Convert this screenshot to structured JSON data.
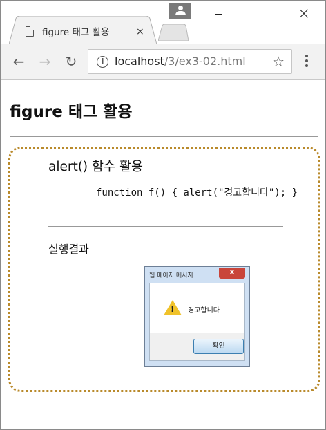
{
  "browser": {
    "tab_title": "figure 태그 활용",
    "tab_close": "×",
    "url_host": "localhost",
    "url_path": "/3/ex3-02.html",
    "nav": {
      "back": "←",
      "forward": "→",
      "reload": "↻"
    },
    "info_icon": "i",
    "star_icon": "☆"
  },
  "page": {
    "heading": "figure 태그 활용",
    "figure": {
      "title": "alert() 함수 활용",
      "code": "function f() { alert(\"경고합니다\"); }",
      "caption": "실행결과",
      "dialog": {
        "title": "웹 페이지 메시지",
        "close": "X",
        "message": "경고합니다",
        "warning_mark": "!",
        "ok_label": "확인"
      }
    }
  },
  "colors": {
    "figure_border": "#b98a2c",
    "tab_background": "#f2f2f2",
    "toolbar_background": "#f2f2f2"
  }
}
